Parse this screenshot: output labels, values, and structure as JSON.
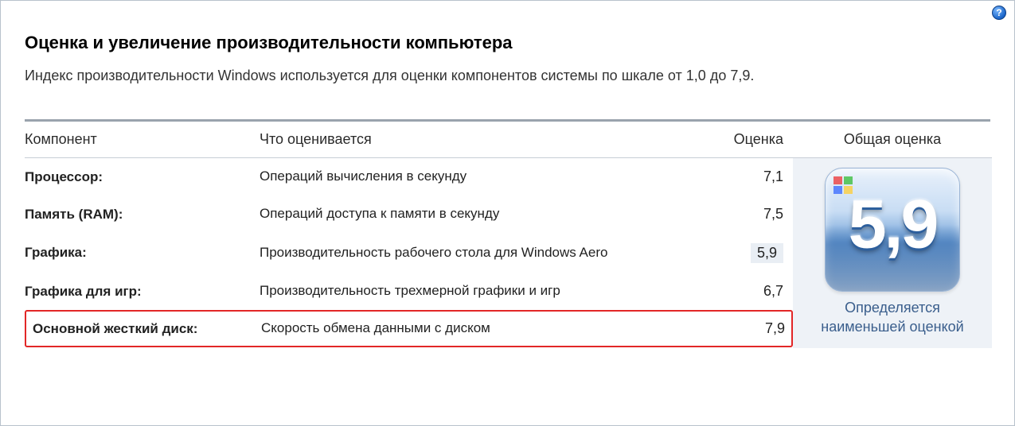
{
  "help_icon_label": "?",
  "heading": "Оценка и увеличение производительности компьютера",
  "subtext": "Индекс производительности Windows используется для оценки компонентов системы по шкале от 1,0 до 7,9.",
  "headers": {
    "component": "Компонент",
    "what": "Что оценивается",
    "score": "Оценка",
    "total": "Общая оценка"
  },
  "rows": [
    {
      "component": "Процессор:",
      "what": "Операций вычисления в секунду",
      "score": "7,1",
      "highlight_score": false,
      "highlight_row": false
    },
    {
      "component": "Память (RAM):",
      "what": "Операций доступа к памяти в секунду",
      "score": "7,5",
      "highlight_score": false,
      "highlight_row": false
    },
    {
      "component": "Графика:",
      "what": "Производительность рабочего стола для Windows Aero",
      "score": "5,9",
      "highlight_score": true,
      "highlight_row": false
    },
    {
      "component": "Графика для игр:",
      "what": "Производительность трехмерной графики и игр",
      "score": "6,7",
      "highlight_score": false,
      "highlight_row": false
    },
    {
      "component": "Основной жесткий диск:",
      "what": "Скорость обмена данными с диском",
      "score": "7,9",
      "highlight_score": false,
      "highlight_row": true
    }
  ],
  "total": {
    "value": "5,9",
    "caption": "Определяется наименьшей оценкой"
  }
}
